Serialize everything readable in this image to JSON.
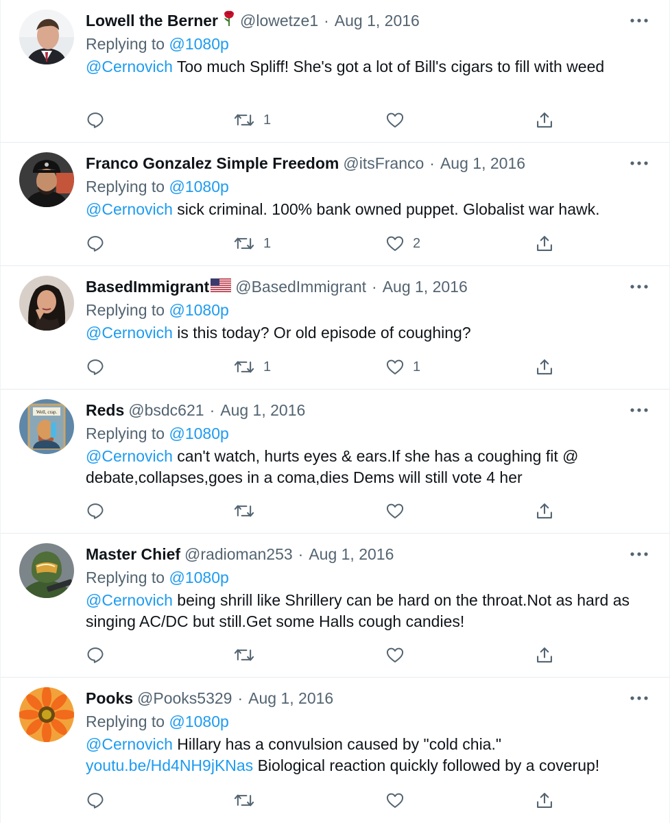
{
  "replying_prefix": "Replying to",
  "replying_handle": "@1080p",
  "mention": "@Cernovich",
  "tweets": [
    {
      "name": "Lowell the Berner",
      "handle": "@lowetze1",
      "date": "Aug 1, 2016",
      "text": "Too much Spliff! She's got a lot of Bill's cigars to fill with weed",
      "replies": "",
      "retweets": "1",
      "likes": ""
    },
    {
      "name": "Franco Gonzalez Simple Freedom",
      "handle": "@itsFranco",
      "date": "Aug 1, 2016",
      "text": "sick criminal. 100% bank owned puppet. Globalist war hawk.",
      "replies": "",
      "retweets": "1",
      "likes": "2"
    },
    {
      "name": "BasedImmigrant",
      "handle": "@BasedImmigrant",
      "date": "Aug 1, 2016",
      "text": "is this today? Or old episode of coughing?",
      "replies": "",
      "retweets": "1",
      "likes": "1"
    },
    {
      "name": "Reds",
      "handle": "@bsdc621",
      "date": "Aug 1, 2016",
      "text": "can't watch, hurts eyes & ears.If she has a coughing fit @ debate,collapses,goes in a coma,dies Dems will still vote 4 her",
      "avatar_caption": "Well, crap.",
      "replies": "",
      "retweets": "",
      "likes": ""
    },
    {
      "name": "Master Chief",
      "handle": "@radioman253",
      "date": "Aug 1, 2016",
      "text": "being shrill like Shrillery can be hard on the throat.Not as hard as singing AC/DC but still.Get some Halls cough candies!",
      "replies": "",
      "retweets": "",
      "likes": ""
    },
    {
      "name": "Pooks",
      "handle": "@Pooks5329",
      "date": "Aug 1, 2016",
      "text": "Hillary has a convulsion caused by \"cold chia.\"",
      "url": "youtu.be/Hd4NH9jKNas",
      "text_after": "Biological reaction quickly followed by a coverup!",
      "replies": "",
      "retweets": "",
      "likes": ""
    }
  ],
  "colors": {
    "link": "#1d9bf0",
    "secondary": "#536471",
    "text": "#0f1419",
    "divider": "#e6ecf0"
  },
  "icons": [
    "rose-icon",
    "us-flag-icon",
    "more-icon",
    "reply-icon",
    "retweet-icon",
    "like-icon",
    "share-icon"
  ]
}
